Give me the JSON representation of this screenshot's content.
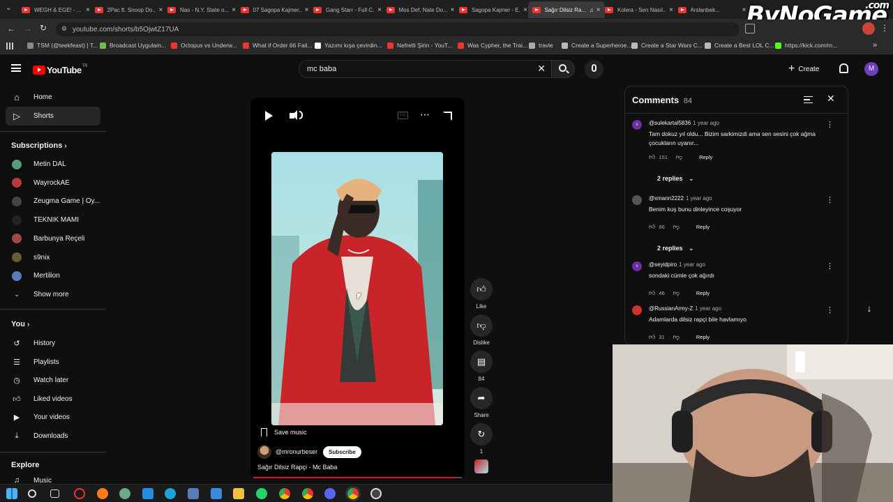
{
  "browser": {
    "tabs": [
      {
        "title": "WEGH & EGE! - ..."
      },
      {
        "title": "2Pac ft. Snoop Do..."
      },
      {
        "title": "Nas - N.Y. State o..."
      },
      {
        "title": "07 Sagopa Kajmer..."
      },
      {
        "title": "Gang Starr - Full C..."
      },
      {
        "title": "Mos Def, Nate Do..."
      },
      {
        "title": "Sagopa Kajmer - E..."
      },
      {
        "title": "Sağır Dilsiz Ra..."
      },
      {
        "title": "Kolera - Sen Nasıl..."
      },
      {
        "title": "Arslanbek..."
      }
    ],
    "url": "youtube.com/shorts/b5OjwtZ17UA",
    "bookmarks": [
      {
        "label": "TSM (@teekfeast) | T...",
        "color": "#888"
      },
      {
        "label": "Broadcast Uygulam...",
        "color": "#6bbd45"
      },
      {
        "label": "Octopus vs Underw...",
        "color": "#e33"
      },
      {
        "label": "What if Order 66 Fail...",
        "color": "#e33"
      },
      {
        "label": "Yazımı kışa çevirdin...",
        "color": "#fff"
      },
      {
        "label": "Nefretli Şirin - YouT...",
        "color": "#e33"
      },
      {
        "label": "Was Cypher, the Trai...",
        "color": "#e33"
      },
      {
        "label": "travle",
        "color": "#aaa"
      },
      {
        "label": "Create a Superheroe...",
        "color": "#bbb"
      },
      {
        "label": "Create a Star Wars C...",
        "color": "#bbb"
      },
      {
        "label": "Create a Best LOL C...",
        "color": "#bbb"
      },
      {
        "label": "https://kick.com/m...",
        "color": "#53fc18"
      }
    ],
    "watermark": "ByNoGame",
    "watermark_suffix": ".com"
  },
  "youtube": {
    "logo_text": "YouTube",
    "region": "TR",
    "search_value": "mc baba",
    "create_label": "Create",
    "avatar_letter": "M"
  },
  "sidebar": {
    "main": [
      {
        "label": "Home",
        "icon": "home-icon"
      },
      {
        "label": "Shorts",
        "icon": "shorts-icon",
        "active": true
      }
    ],
    "subscriptions_title": "Subscriptions",
    "subscriptions": [
      {
        "label": "Metin DAL",
        "color": "#5a9a7a"
      },
      {
        "label": "WayrockAE",
        "color": "#b83a3a"
      },
      {
        "label": "Zeugma Game | Oy...",
        "color": "#444"
      },
      {
        "label": "TEKNIK MAMI",
        "color": "#222"
      },
      {
        "label": "Barbunya Reçeli",
        "color": "#a04848"
      },
      {
        "label": "s9nix",
        "color": "#6a5a3a"
      },
      {
        "label": "Mertilion",
        "color": "#5a7ab8"
      }
    ],
    "show_more": "Show more",
    "you_title": "You",
    "you": [
      {
        "label": "History",
        "icon": "history-icon"
      },
      {
        "label": "Playlists",
        "icon": "playlists-icon"
      },
      {
        "label": "Watch later",
        "icon": "watch-later-icon"
      },
      {
        "label": "Liked videos",
        "icon": "thumbs-up-icon"
      },
      {
        "label": "Your videos",
        "icon": "your-videos-icon"
      },
      {
        "label": "Downloads",
        "icon": "download-icon"
      }
    ],
    "explore_title": "Explore",
    "explore": [
      {
        "label": "Music",
        "icon": "music-icon"
      }
    ]
  },
  "short": {
    "save_music": "Save music",
    "channel": "@mronurbeser",
    "subscribe": "Subscribe",
    "title": "Sağır Dilsiz Rapçi - Mc Baba",
    "progress": 0.97,
    "actions": {
      "like": "Like",
      "dislike": "Dislike",
      "comments": "84",
      "share": "Share",
      "remix": "1"
    }
  },
  "comments": {
    "title": "Comments",
    "count": "84",
    "items": [
      {
        "author": "@sulekartal5836",
        "time": "1 year ago",
        "text": "Tam dokuz yıl oldu... Bizim sarkimizdi ama sen sesini çok ağma çocukların uyanır...",
        "likes": "151",
        "avatar": "s",
        "avatar_color": "#6b2fa0",
        "replies": "2 replies"
      },
      {
        "author": "@xmann2222",
        "time": "1 year ago",
        "text": "Benim kuş bunu dinleyince coşuyor",
        "likes": "86",
        "avatar": "",
        "avatar_color": "#555",
        "replies": "2 replies"
      },
      {
        "author": "@seyidpiro",
        "time": "1 year ago",
        "text": "sondaki cümle çok ağırdı",
        "likes": "46",
        "avatar": "s",
        "avatar_color": "#6b2fa0",
        "replies": ""
      },
      {
        "author": "@RussianArmy-Z",
        "time": "1 year ago",
        "text": "Adamlarda dilsiz rapçi bile havlamıyo",
        "likes": "31",
        "avatar": "",
        "avatar_color": "#c33",
        "replies": ""
      }
    ],
    "reply_label": "Reply"
  }
}
